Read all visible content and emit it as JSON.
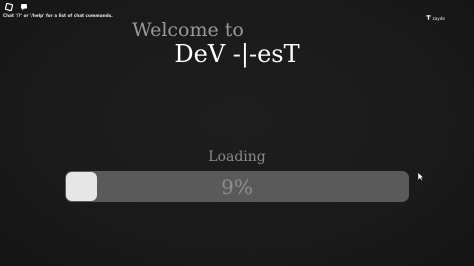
{
  "topbar": {
    "menu_icon": "roblox-menu-icon",
    "chat_icon": "chat-icon",
    "chat_hint": "Chat '/?' or '/help' for a list of chat commands."
  },
  "user": {
    "icon": "user-tag-icon",
    "name": "zayde"
  },
  "loading_screen": {
    "welcome_text": "Welcome to",
    "game_title": "DeV -|-esT",
    "loading_label": "Loading",
    "progress_percent": 9,
    "progress_text": "9%"
  },
  "colors": {
    "background": "#1a1a1a",
    "track": "#5a5a5a",
    "fill": "#e6e6e6",
    "muted_text": "#8a8a8a",
    "title_text": "#ffffff"
  }
}
